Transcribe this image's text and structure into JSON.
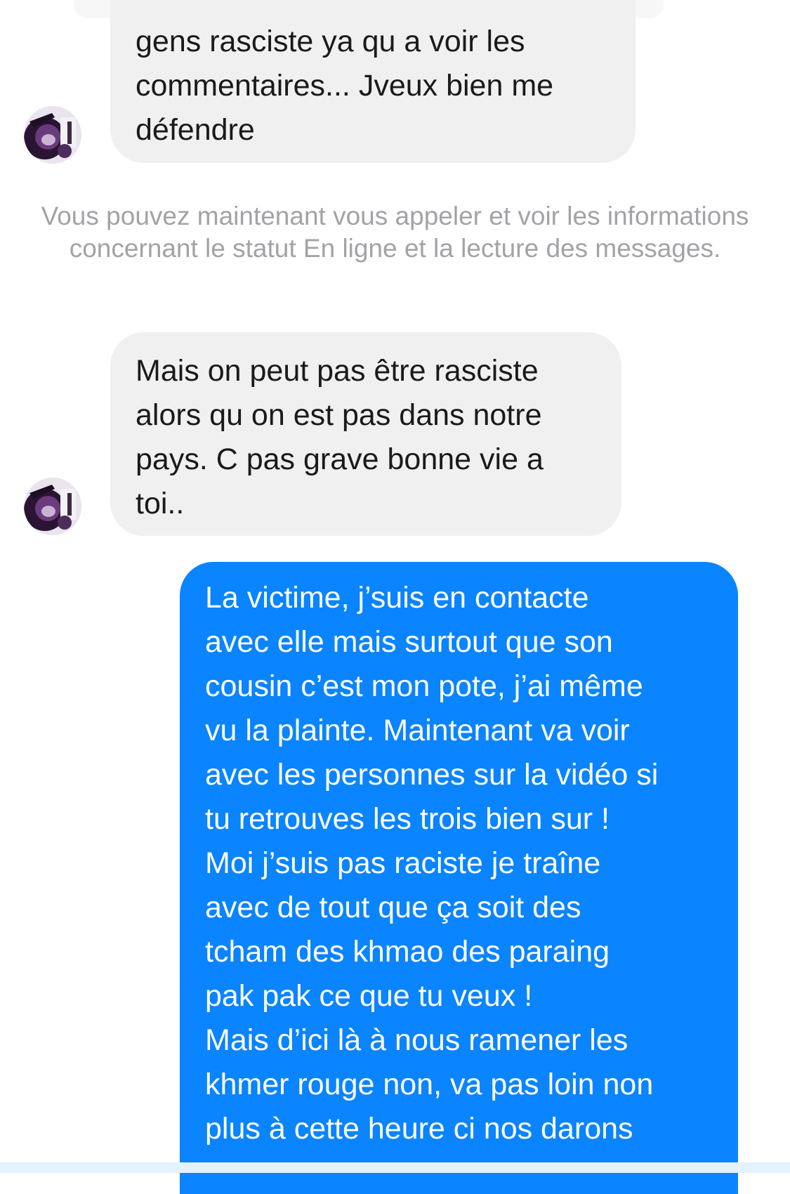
{
  "conversation": {
    "messages": [
      {
        "direction": "incoming",
        "text": "gens rasciste ya qu a voir les\ncommentaires... Jveux bien me\ndéfendre"
      },
      {
        "direction": "incoming",
        "text": "Mais on peut pas être rasciste\nalors qu on est pas dans notre\npays. C pas grave bonne vie a\ntoi.."
      },
      {
        "direction": "outgoing",
        "text": "La victime, j’suis en contacte\navec elle mais surtout que son\ncousin c’est mon pote, j’ai même\nvu la plainte. Maintenant va voir\navec les personnes sur la vidéo si\ntu retrouves les trois bien sur !\nMoi j’suis pas raciste je traîne\navec de tout que ça soit des\ntcham des khmao des paraing\npak pak ce que tu veux !\nMais d’ici là à nous ramener les\nkhmer rouge non, va pas loin non\nplus à cette heure ci nos darons"
      }
    ],
    "system_notice": "Vous pouvez maintenant vous appeler et voir les informations concernant le statut En ligne et la lecture des messages."
  },
  "colors": {
    "incoming_bubble": "#f0f0f1",
    "outgoing_bubble": "#0a84ff",
    "notice_text": "#a3a3a7"
  },
  "icons": {
    "contact_avatar": "contact-avatar-icon"
  }
}
